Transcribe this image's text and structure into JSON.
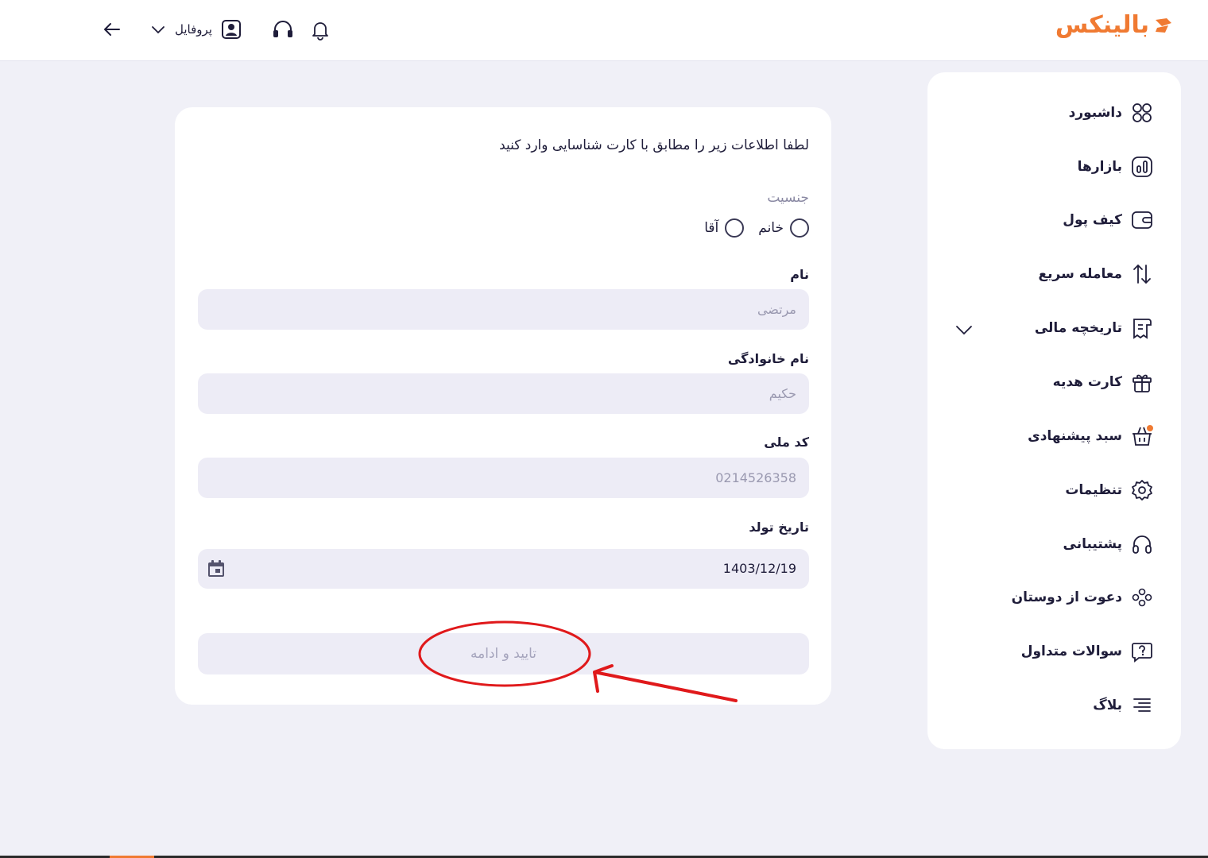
{
  "header": {
    "logo_text": "بالینکس",
    "profile_label": "پروفایل",
    "brand_color": "#f07a32",
    "icons": [
      "back-arrow-icon",
      "chevron-down-icon",
      "user-icon",
      "headset-icon",
      "bell-icon"
    ]
  },
  "sidebar": {
    "items": [
      {
        "label": "داشبورد",
        "icon": "dashboard-icon"
      },
      {
        "label": "بازارها",
        "icon": "markets-icon"
      },
      {
        "label": "کیف پول",
        "icon": "wallet-icon"
      },
      {
        "label": "معامله سریع",
        "icon": "swap-arrows-icon"
      },
      {
        "label": "تاریخچه مالی",
        "icon": "receipt-icon"
      },
      {
        "label": "کارت هدیه",
        "icon": "gift-icon"
      },
      {
        "label": "سبد پیشنهادی",
        "icon": "basket-icon"
      },
      {
        "label": "تنظیمات",
        "icon": "gear-icon"
      },
      {
        "label": "پشتیبانی",
        "icon": "headset-icon"
      },
      {
        "label": "دعوت از دوستان",
        "icon": "users-icon"
      },
      {
        "label": "سوالات متداول",
        "icon": "question-icon"
      },
      {
        "label": "بلاگ",
        "icon": "menu-lines-icon"
      }
    ]
  },
  "form": {
    "title": "لطفا اطلاعات زیر را مطابق با کارت شناسایی وارد کنید",
    "gender_label": "جنسیت",
    "gender_options": [
      "خانم",
      "آقا"
    ],
    "first_name_label": "نام",
    "first_name_placeholder": "مرتضی",
    "last_name_label": "نام خانوادگی",
    "last_name_placeholder": "حکیم",
    "national_code_label": "کد ملی",
    "national_code_placeholder": "0214526358",
    "birth_date_label": "تاریخ تولد",
    "birth_date_value": "1403/12/19",
    "submit_label": "تایید و ادامه"
  },
  "annotation_color": "#e0191b"
}
